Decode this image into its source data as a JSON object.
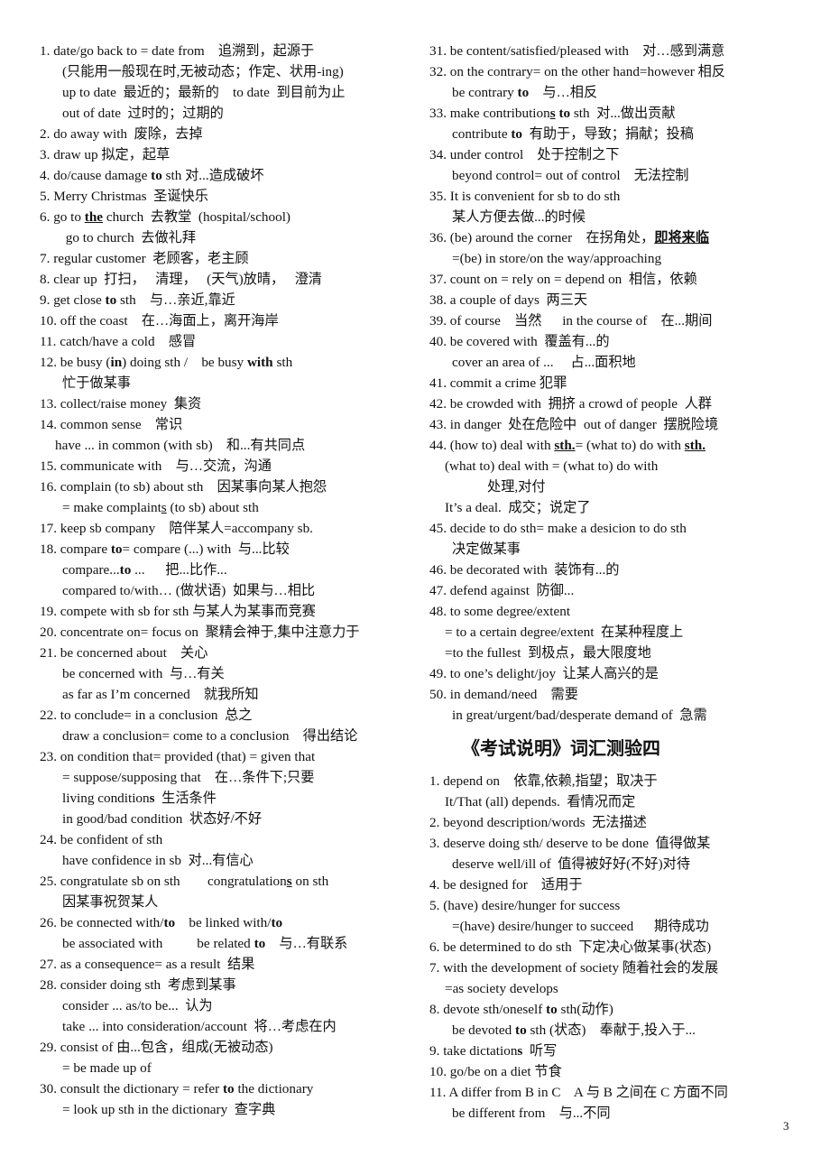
{
  "page_number": "3",
  "section_title": "《考试说明》词汇测验四",
  "left_column": [
    {
      "indent": 0,
      "segs": [
        [
          "1. date/go back to = date from    追溯到，起源于",
          ""
        ]
      ]
    },
    {
      "indent": 1,
      "segs": [
        [
          "(只能用一般现在时,无被动态；作定、状用-ing)",
          ""
        ]
      ]
    },
    {
      "indent": 1,
      "segs": [
        [
          "up to date  最近的；最新的    to date  到目前为止",
          ""
        ]
      ]
    },
    {
      "indent": 1,
      "segs": [
        [
          "out of date  过时的；过期的",
          ""
        ]
      ]
    },
    {
      "indent": 0,
      "segs": [
        [
          "2. do away with  废除，去掉",
          ""
        ]
      ]
    },
    {
      "indent": 0,
      "segs": [
        [
          "3. draw up 拟定，起草",
          ""
        ]
      ]
    },
    {
      "indent": 0,
      "segs": [
        [
          "4. do/cause damage ",
          ""
        ],
        [
          "to",
          "b"
        ],
        [
          " sth 对...造成破坏",
          ""
        ]
      ]
    },
    {
      "indent": 0,
      "segs": [
        [
          "5. Merry Christmas  圣诞快乐",
          ""
        ]
      ]
    },
    {
      "indent": 0,
      "segs": [
        [
          "6. go to ",
          ""
        ],
        [
          "the",
          "bu"
        ],
        [
          " church  去教堂  (hospital/school)",
          ""
        ]
      ]
    },
    {
      "indent": 1,
      "segs": [
        [
          " go to church  去做礼拜",
          ""
        ]
      ]
    },
    {
      "indent": 0,
      "segs": [
        [
          "7. regular customer  老顾客，老主顾",
          ""
        ]
      ]
    },
    {
      "indent": 0,
      "segs": [
        [
          "8. clear up  打扫，   清理，   (天气)放晴，   澄清",
          ""
        ]
      ]
    },
    {
      "indent": 0,
      "segs": [
        [
          "9. get close ",
          ""
        ],
        [
          "to",
          "b"
        ],
        [
          " sth    与…亲近,靠近",
          ""
        ]
      ]
    },
    {
      "indent": 0,
      "segs": [
        [
          "10. off the coast    在…海面上，离开海岸",
          ""
        ]
      ]
    },
    {
      "indent": 0,
      "segs": [
        [
          "11. catch/have a cold    感冒",
          ""
        ]
      ]
    },
    {
      "indent": 0,
      "segs": [
        [
          "12. be busy (",
          ""
        ],
        [
          "in",
          "b"
        ],
        [
          ") doing sth /    be busy ",
          ""
        ],
        [
          "with",
          "b"
        ],
        [
          " sth",
          ""
        ]
      ]
    },
    {
      "indent": 1,
      "segs": [
        [
          "忙于做某事",
          ""
        ]
      ]
    },
    {
      "indent": 0,
      "segs": [
        [
          "13. collect/raise money  集资",
          ""
        ]
      ]
    },
    {
      "indent": 0,
      "segs": [
        [
          "14. common sense    常识",
          ""
        ]
      ]
    },
    {
      "indent": 9,
      "segs": [
        [
          "have ... in common (with sb)    和...有共同点",
          ""
        ]
      ]
    },
    {
      "indent": 0,
      "segs": [
        [
          "15. communicate with    与…交流，沟通",
          ""
        ]
      ]
    },
    {
      "indent": 0,
      "segs": [
        [
          "16. complain (to sb) about sth    因某事向某人抱怨",
          ""
        ]
      ]
    },
    {
      "indent": 1,
      "segs": [
        [
          "= make complaint",
          ""
        ],
        [
          "s",
          "u"
        ],
        [
          " (to sb) about sth",
          ""
        ]
      ]
    },
    {
      "indent": 0,
      "segs": [
        [
          "17. keep sb company    陪伴某人=accompany sb.",
          ""
        ]
      ]
    },
    {
      "indent": 0,
      "segs": [
        [
          "18. compare ",
          ""
        ],
        [
          "to",
          "b"
        ],
        [
          "= compare (...) with  与...比较",
          ""
        ]
      ]
    },
    {
      "indent": 1,
      "segs": [
        [
          "compare...",
          ""
        ],
        [
          "to",
          "b"
        ],
        [
          " ...      把...比作...",
          ""
        ]
      ]
    },
    {
      "indent": 1,
      "segs": [
        [
          "compared to/with… (做状语)  如果与…相比",
          ""
        ]
      ]
    },
    {
      "indent": 0,
      "segs": [
        [
          "19. compete with sb for sth 与某人为某事而竞赛",
          ""
        ]
      ]
    },
    {
      "indent": 0,
      "segs": [
        [
          "20. concentrate on= focus on  聚精会神于,集中注意力于",
          ""
        ]
      ]
    },
    {
      "indent": 0,
      "segs": [
        [
          "21. be concerned about    关心",
          ""
        ]
      ]
    },
    {
      "indent": 1,
      "segs": [
        [
          "be concerned with  与…有关",
          ""
        ]
      ]
    },
    {
      "indent": 1,
      "segs": [
        [
          "as far as I’m concerned    就我所知",
          ""
        ]
      ]
    },
    {
      "indent": 0,
      "segs": [
        [
          "22. to conclude= in a conclusion  总之",
          ""
        ]
      ]
    },
    {
      "indent": 1,
      "segs": [
        [
          "draw a conclusion= come to a conclusion    得出结论",
          ""
        ]
      ]
    },
    {
      "indent": 0,
      "segs": [
        [
          "23. on condition that= provided (that) = given that",
          ""
        ]
      ]
    },
    {
      "indent": 1,
      "segs": [
        [
          "= suppose/supposing that    在…条件下;只要",
          ""
        ]
      ]
    },
    {
      "indent": 1,
      "segs": [
        [
          "living condition",
          ""
        ],
        [
          "s",
          "b"
        ],
        [
          "  生活条件",
          ""
        ]
      ]
    },
    {
      "indent": 1,
      "segs": [
        [
          "in good/bad condition  状态好/不好",
          ""
        ]
      ]
    },
    {
      "indent": 0,
      "segs": [
        [
          "24. be confident of sth",
          ""
        ]
      ]
    },
    {
      "indent": 1,
      "segs": [
        [
          "have confidence in sb  对...有信心",
          ""
        ]
      ]
    },
    {
      "indent": 0,
      "segs": [
        [
          "25. congratulate sb on sth        congratulation",
          ""
        ],
        [
          "s",
          "bu"
        ],
        [
          " on sth",
          ""
        ]
      ]
    },
    {
      "indent": 1,
      "segs": [
        [
          "因某事祝贺某人",
          ""
        ]
      ]
    },
    {
      "indent": 0,
      "segs": [
        [
          "26. be connected with/",
          ""
        ],
        [
          "to",
          "b"
        ],
        [
          "    be linked with/",
          ""
        ],
        [
          "to",
          "b"
        ]
      ]
    },
    {
      "indent": 1,
      "segs": [
        [
          "be associated with          be related ",
          ""
        ],
        [
          "to",
          "b"
        ],
        [
          "    与…有联系",
          ""
        ]
      ]
    },
    {
      "indent": 0,
      "segs": [
        [
          "27. as a consequence= as a result  结果",
          ""
        ]
      ]
    },
    {
      "indent": 0,
      "segs": [
        [
          "28. consider doing sth  考虑到某事",
          ""
        ]
      ]
    },
    {
      "indent": 1,
      "segs": [
        [
          "consider ... as/to be...  认为",
          ""
        ]
      ]
    },
    {
      "indent": 1,
      "segs": [
        [
          "take ... into consideration/account  将…考虑在内",
          ""
        ]
      ]
    },
    {
      "indent": 0,
      "segs": [
        [
          "29. consist of 由...包含，组成(无被动态)",
          ""
        ]
      ]
    },
    {
      "indent": 1,
      "segs": [
        [
          "= be made up of",
          ""
        ]
      ]
    },
    {
      "indent": 0,
      "segs": [
        [
          "30. consult the dictionary = refer ",
          ""
        ],
        [
          "to",
          "b"
        ],
        [
          " the dictionary",
          ""
        ]
      ]
    },
    {
      "indent": 1,
      "segs": [
        [
          "= look up sth in the dictionary  查字典",
          ""
        ]
      ]
    }
  ],
  "right_column": [
    {
      "indent": 0,
      "segs": [
        [
          "31. be content/satisfied/pleased with    对…感到满意",
          ""
        ]
      ]
    },
    {
      "indent": 0,
      "segs": [
        [
          "32. on the contrary= on the other hand=however 相反",
          ""
        ]
      ]
    },
    {
      "indent": 1,
      "segs": [
        [
          "be contrary ",
          ""
        ],
        [
          "to",
          "b"
        ],
        [
          "    与…相反",
          ""
        ]
      ]
    },
    {
      "indent": 0,
      "segs": [
        [
          "33. make contribution",
          ""
        ],
        [
          "s",
          "bu"
        ],
        [
          " ",
          ""
        ],
        [
          "to",
          "b"
        ],
        [
          " sth  对...做出贡献",
          ""
        ]
      ]
    },
    {
      "indent": 1,
      "segs": [
        [
          "contribute ",
          ""
        ],
        [
          "to",
          "b"
        ],
        [
          "  有助于，导致；捐献；投稿",
          ""
        ]
      ]
    },
    {
      "indent": 0,
      "segs": [
        [
          "34. under control    处于控制之下",
          ""
        ]
      ]
    },
    {
      "indent": 1,
      "segs": [
        [
          "beyond control= out of control    无法控制",
          ""
        ]
      ]
    },
    {
      "indent": 0,
      "segs": [
        [
          "35. It is convenient for sb to do sth",
          ""
        ]
      ]
    },
    {
      "indent": 1,
      "segs": [
        [
          "某人方便去做...的时候",
          ""
        ]
      ]
    },
    {
      "indent": 0,
      "segs": [
        [
          "36. (be) around the corner    在拐角处，",
          ""
        ],
        [
          "即将来临",
          "bu"
        ]
      ]
    },
    {
      "indent": 1,
      "segs": [
        [
          "=(be) in store/on the way/approaching",
          ""
        ]
      ]
    },
    {
      "indent": 0,
      "segs": [
        [
          "37. count on = rely on = depend on  相信，依赖",
          ""
        ]
      ]
    },
    {
      "indent": 0,
      "segs": [
        [
          "38. a couple of days  两三天",
          ""
        ]
      ]
    },
    {
      "indent": 0,
      "segs": [
        [
          "39. of course    当然      in the course of    在...期间",
          ""
        ]
      ]
    },
    {
      "indent": 0,
      "segs": [
        [
          "40. be covered with  覆盖有...的",
          ""
        ]
      ]
    },
    {
      "indent": 1,
      "segs": [
        [
          "cover an area of ...     占...面积地",
          ""
        ]
      ]
    },
    {
      "indent": 0,
      "segs": [
        [
          "41. commit a crime 犯罪",
          ""
        ]
      ]
    },
    {
      "indent": 0,
      "segs": [
        [
          "42. be crowded with  拥挤 a crowd of people  人群",
          ""
        ]
      ]
    },
    {
      "indent": 0,
      "segs": [
        [
          "43. in danger  处在危险中  out of danger  摆脱险境",
          ""
        ]
      ]
    },
    {
      "indent": 0,
      "segs": [
        [
          "44. (how to) deal with ",
          ""
        ],
        [
          "sth.",
          "bu"
        ],
        [
          "= (what to) do with ",
          ""
        ],
        [
          "sth.",
          "bu"
        ]
      ]
    },
    {
      "indent": 9,
      "segs": [
        [
          "(what to) deal with = (what to) do with",
          ""
        ]
      ]
    },
    {
      "indent": 2,
      "segs": [
        [
          "处理,对付",
          ""
        ]
      ]
    },
    {
      "indent": 9,
      "segs": [
        [
          "It’s a deal.  成交；说定了",
          ""
        ]
      ]
    },
    {
      "indent": 0,
      "segs": [
        [
          "45. decide to do sth= make a desicion to do sth",
          ""
        ]
      ]
    },
    {
      "indent": 1,
      "segs": [
        [
          "决定做某事",
          ""
        ]
      ]
    },
    {
      "indent": 0,
      "segs": [
        [
          "46. be decorated with  装饰有...的",
          ""
        ]
      ]
    },
    {
      "indent": 0,
      "segs": [
        [
          "47. defend against  防御...",
          ""
        ]
      ]
    },
    {
      "indent": 0,
      "segs": [
        [
          "48. to some degree/extent",
          ""
        ]
      ]
    },
    {
      "indent": 9,
      "segs": [
        [
          "= to a certain degree/extent  在某种程度上",
          ""
        ]
      ]
    },
    {
      "indent": 9,
      "segs": [
        [
          "=to the fullest  到极点，最大限度地",
          ""
        ]
      ]
    },
    {
      "indent": 0,
      "segs": [
        [
          "49. to one’s delight/joy  让某人高兴的是",
          ""
        ]
      ]
    },
    {
      "indent": 0,
      "segs": [
        [
          "50. in demand/need    需要",
          ""
        ]
      ]
    },
    {
      "indent": 1,
      "segs": [
        [
          "in great/urgent/bad/desperate demand of  急需",
          ""
        ]
      ]
    }
  ],
  "right_column_after_title": [
    {
      "indent": 0,
      "segs": [
        [
          "1. depend on    依靠,依赖,指望；取决于",
          ""
        ]
      ]
    },
    {
      "indent": 9,
      "segs": [
        [
          "It/That (all) depends.  看情况而定",
          ""
        ]
      ]
    },
    {
      "indent": 0,
      "segs": [
        [
          "2. beyond description/words  无法描述",
          ""
        ]
      ]
    },
    {
      "indent": 0,
      "segs": [
        [
          "3. deserve doing sth/ deserve to be done  值得做某",
          ""
        ]
      ]
    },
    {
      "indent": 1,
      "segs": [
        [
          "deserve well/ill of  值得被好好(不好)对待",
          ""
        ]
      ]
    },
    {
      "indent": 0,
      "segs": [
        [
          "4. be designed for    适用于",
          ""
        ]
      ]
    },
    {
      "indent": 0,
      "segs": [
        [
          "5. (have) desire/hunger for success",
          ""
        ]
      ]
    },
    {
      "indent": 1,
      "segs": [
        [
          "=(have) desire/hunger to succeed      期待成功",
          ""
        ]
      ]
    },
    {
      "indent": 0,
      "segs": [
        [
          "6. be determined to do sth  下定决心做某事(状态)",
          ""
        ]
      ]
    },
    {
      "indent": 0,
      "segs": [
        [
          "7. with the development of society 随着社会的发展",
          ""
        ]
      ]
    },
    {
      "indent": 9,
      "segs": [
        [
          "=as society develops",
          ""
        ]
      ]
    },
    {
      "indent": 0,
      "segs": [
        [
          "8. devote sth/oneself ",
          ""
        ],
        [
          "to",
          "b"
        ],
        [
          " sth(动作)",
          ""
        ]
      ]
    },
    {
      "indent": 1,
      "segs": [
        [
          "be devoted ",
          ""
        ],
        [
          "to",
          "b"
        ],
        [
          " sth (状态)    奉献于,投入于...",
          ""
        ]
      ]
    },
    {
      "indent": 0,
      "segs": [
        [
          "9. take dictation",
          ""
        ],
        [
          "s",
          "b"
        ],
        [
          "  听写",
          ""
        ]
      ]
    },
    {
      "indent": 0,
      "segs": [
        [
          "10. go/be on a diet 节食",
          ""
        ]
      ]
    },
    {
      "indent": 0,
      "segs": [
        [
          "11. A differ from B in C    A 与 B 之间在 C 方面不同",
          ""
        ]
      ]
    },
    {
      "indent": 1,
      "segs": [
        [
          "be different from    与...不同",
          ""
        ]
      ]
    }
  ]
}
